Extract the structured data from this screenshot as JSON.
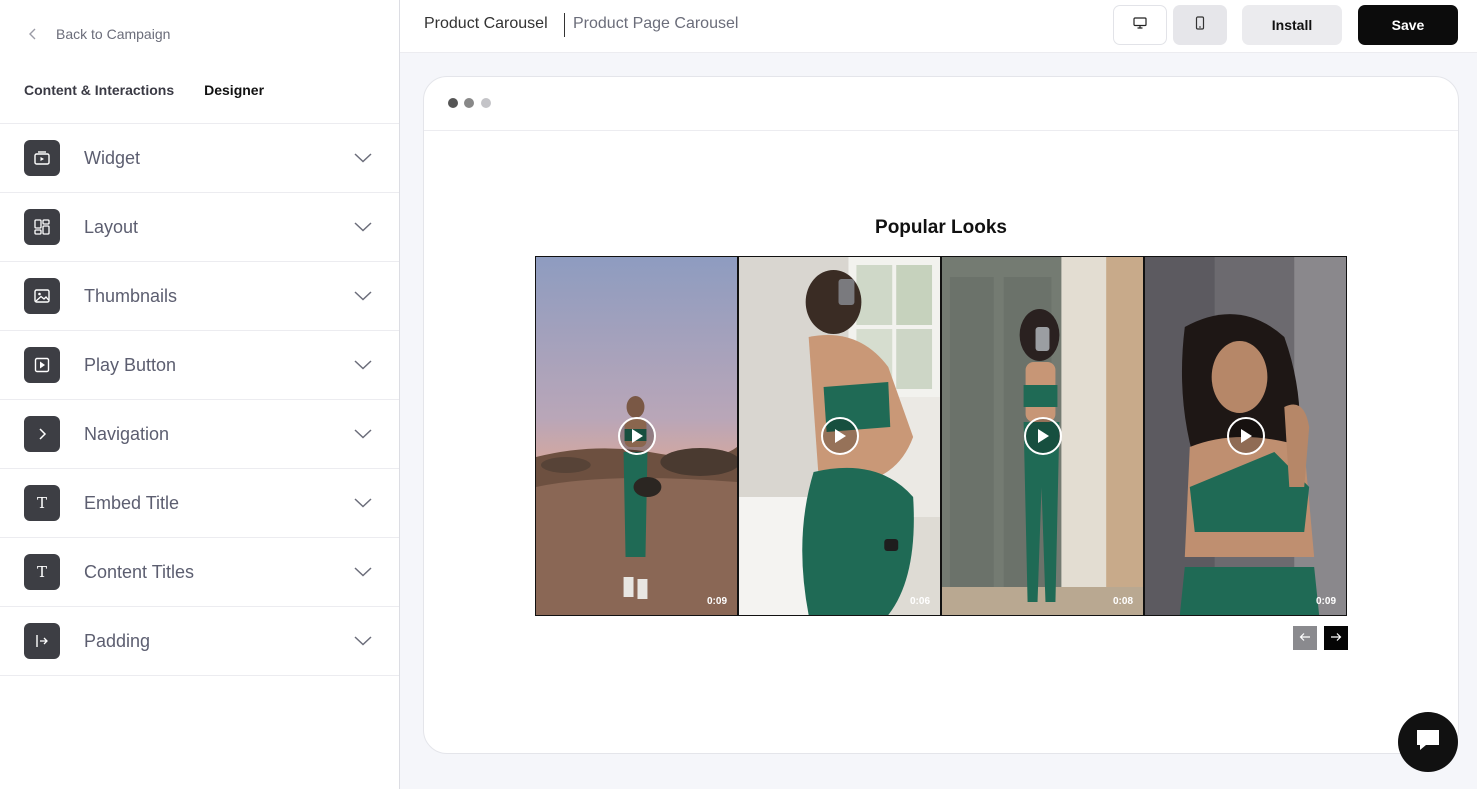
{
  "sidebar": {
    "back_label": "Back to Campaign",
    "tabs": [
      {
        "label": "Content & Interactions",
        "active": false
      },
      {
        "label": "Designer",
        "active": true
      }
    ],
    "sections": [
      {
        "label": "Widget",
        "icon": "widget-icon"
      },
      {
        "label": "Layout",
        "icon": "layout-icon"
      },
      {
        "label": "Thumbnails",
        "icon": "image-icon"
      },
      {
        "label": "Play Button",
        "icon": "play-square-icon"
      },
      {
        "label": "Navigation",
        "icon": "chevron-right-icon"
      },
      {
        "label": "Embed Title",
        "icon": "text-icon",
        "glyph": "T"
      },
      {
        "label": "Content Titles",
        "icon": "text-icon",
        "glyph": "T"
      },
      {
        "label": "Padding",
        "icon": "padding-icon"
      }
    ]
  },
  "header": {
    "breadcrumb_primary": "Product Carousel",
    "breadcrumb_secondary": "Product Page Carousel",
    "install_label": "Install",
    "save_label": "Save"
  },
  "preview": {
    "embed_title": "Popular Looks",
    "slides": [
      {
        "duration": "0:09"
      },
      {
        "duration": "0:06"
      },
      {
        "duration": "0:08"
      },
      {
        "duration": "0:09"
      }
    ]
  },
  "colors": {
    "accent": "#0c0c0c",
    "sidebar_icon_bg": "#3d3e44",
    "outfit_green": "#1f6a55"
  }
}
